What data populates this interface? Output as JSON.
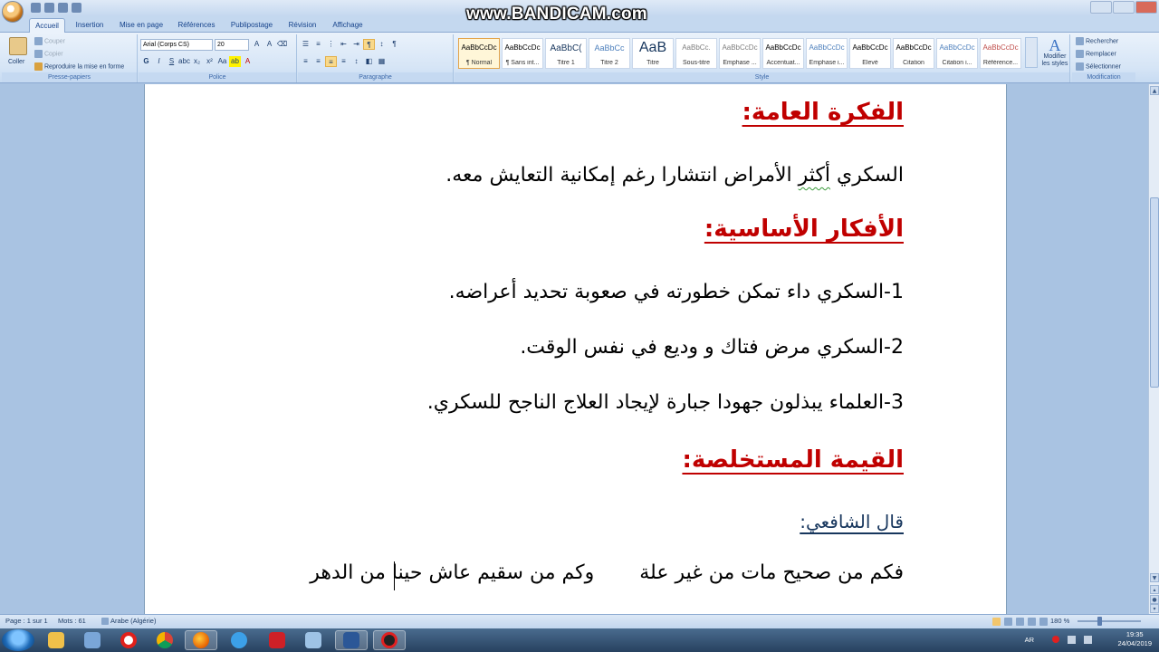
{
  "watermark": "www.BANDICAM.com",
  "ribbon_tabs": [
    "Accueil",
    "Insertion",
    "Mise en page",
    "Références",
    "Publipostage",
    "Révision",
    "Affichage"
  ],
  "clipboard": {
    "paste": "Coller",
    "cut": "Couper",
    "copy": "Copier",
    "format_painter": "Reproduire la mise en forme",
    "label": "Presse-papiers"
  },
  "font": {
    "family": "Arial (Corps CS)",
    "size": "20",
    "label": "Police"
  },
  "paragraph": {
    "label": "Paragraphe"
  },
  "styles": {
    "label": "Style",
    "items": [
      {
        "sample": "AaBbCcDc",
        "name": "¶ Normal"
      },
      {
        "sample": "AaBbCcDc",
        "name": "¶ Sans int..."
      },
      {
        "sample": "AaBbC(",
        "name": "Titre 1"
      },
      {
        "sample": "AaBbCc",
        "name": "Titre 2"
      },
      {
        "sample": "AaB",
        "name": "Titre"
      },
      {
        "sample": "AaBbCc.",
        "name": "Sous-titre"
      },
      {
        "sample": "AaBbCcDc",
        "name": "Emphase ..."
      },
      {
        "sample": "AaBbCcDc",
        "name": "Accentuat..."
      },
      {
        "sample": "AaBbCcDc",
        "name": "Emphase i..."
      },
      {
        "sample": "AaBbCcDc",
        "name": "Élevé"
      },
      {
        "sample": "AaBbCcDc",
        "name": "Citation"
      },
      {
        "sample": "AaBbCcDc",
        "name": "Citation i..."
      },
      {
        "sample": "AaBbCcDc",
        "name": "Référence..."
      }
    ],
    "change_styles": "Modifier les styles"
  },
  "editing": {
    "find": "Rechercher",
    "replace": "Remplacer",
    "select": "Sélectionner",
    "label": "Modification"
  },
  "document": {
    "heading1": "الفكرة العامة:",
    "general_idea_pre": "السكري ",
    "general_idea_flagged": "أكثر",
    "general_idea_post": " الأمراض انتشارا رغم إمكانية التعايش معه.",
    "heading2": "الأفكار الأساسية:",
    "idea1": "1-السكري داء تمكن خطورته في صعوبة تحديد أعراضه.",
    "idea2": "2-السكري مرض فتاك و وديع في نفس الوقت.",
    "idea3": "3-العلماء يبذلون جهودا جبارة لإيجاد العلاج الناجح للسكري.",
    "heading3": "القيمة المستخلصة:",
    "quote_intro": "قال الشافعي:",
    "verse_hemistich1": "فكم من صحيح مات من غير علة",
    "verse_hemistich2": "وكم من سقيم عاش حينا من الدهر"
  },
  "status": {
    "page": "Page : 1 sur 1",
    "words": "Mots : 61",
    "language": "Arabe (Algérie)",
    "zoom": "180 %"
  },
  "taskbar": {
    "language": "AR",
    "time": "19:35",
    "date": "24/04/2019"
  },
  "colors": {
    "heading": "#c00000",
    "quote_intro": "#17365d",
    "ribbon_bg": "#d6e5f6",
    "workspace": "#a9c3e2"
  }
}
